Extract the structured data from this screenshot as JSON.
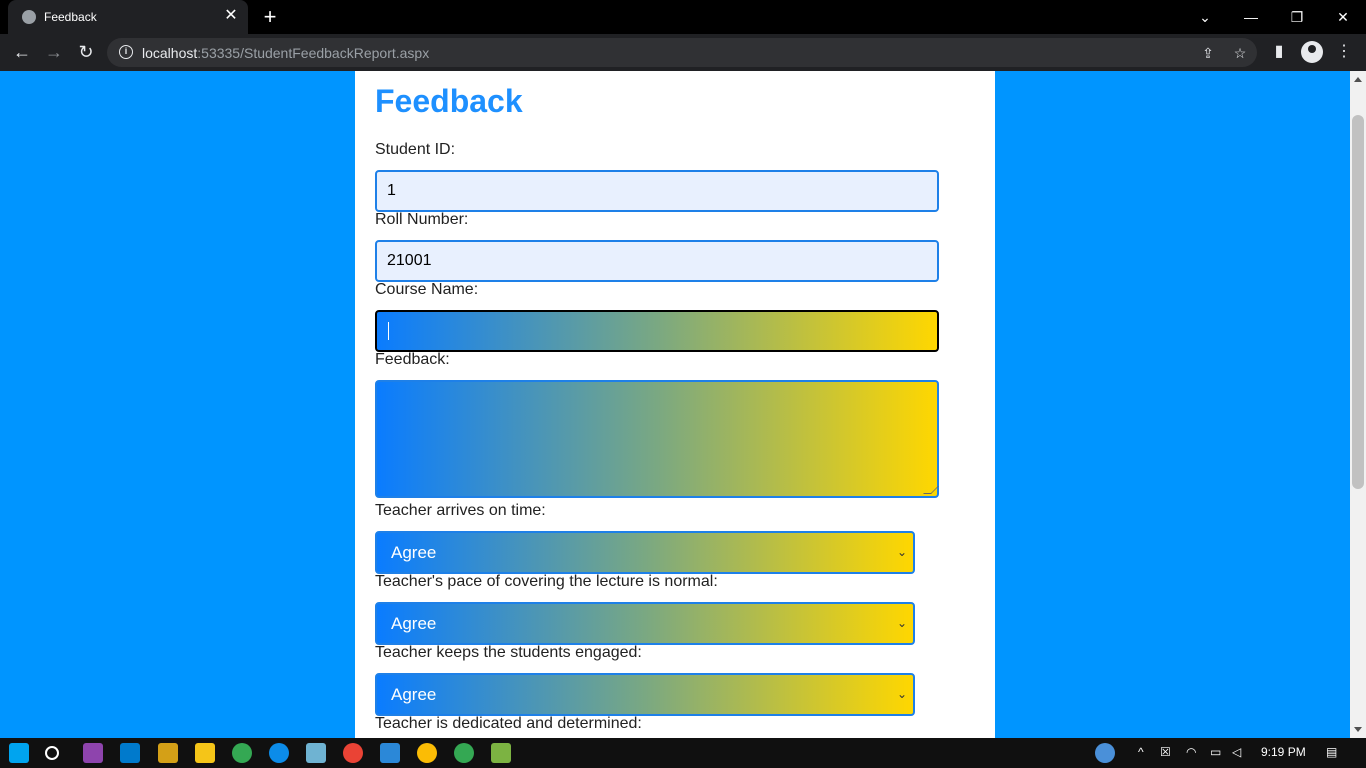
{
  "browser": {
    "tab_title": "Feedback",
    "url_host": "localhost",
    "url_rest": ":53335/StudentFeedbackReport.aspx"
  },
  "page": {
    "title": "Feedback",
    "fields": {
      "student_id_label": "Student ID:",
      "student_id_value": "1",
      "roll_number_label": "Roll Number:",
      "roll_number_value": "21001",
      "course_name_label": "Course Name:",
      "course_name_value": "",
      "feedback_label": "Feedback:",
      "feedback_value": ""
    },
    "questions": [
      {
        "label": "Teacher arrives on time:",
        "value": "Agree"
      },
      {
        "label": "Teacher's pace of covering the lecture is normal:",
        "value": "Agree"
      },
      {
        "label": "Teacher keeps the students engaged:",
        "value": "Agree"
      },
      {
        "label": "Teacher is dedicated and determined:",
        "value": ""
      }
    ]
  },
  "taskbar": {
    "time": "9:19 PM"
  },
  "colors": {
    "page_bg": "#0095ff",
    "title": "#1e90ff",
    "gradient_start": "#0a7cff",
    "gradient_end": "#ffd700"
  }
}
